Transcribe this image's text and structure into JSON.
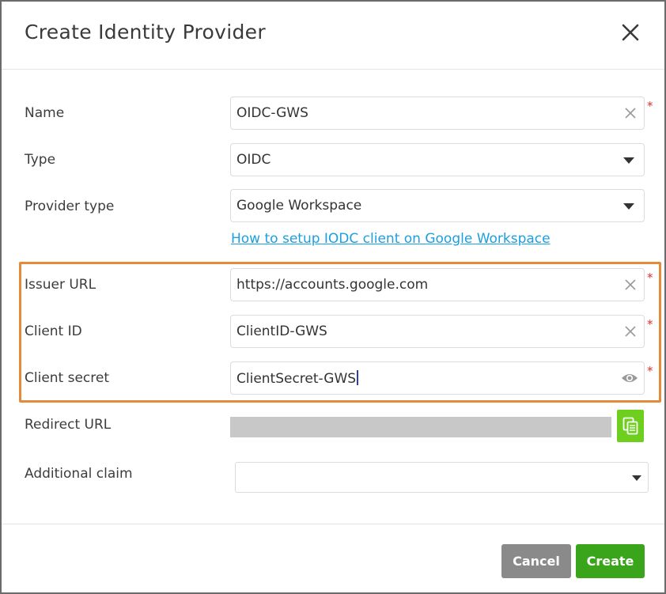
{
  "dialog": {
    "title": "Create Identity Provider",
    "close_icon": "close-icon"
  },
  "form": {
    "name": {
      "label": "Name",
      "value": "OIDC-GWS",
      "required_mark": "*",
      "icon": "clear-icon"
    },
    "type": {
      "label": "Type",
      "value": "OIDC",
      "icon": "caret-down-icon"
    },
    "provider_type": {
      "label": "Provider type",
      "value": "Google Workspace",
      "icon": "caret-down-icon"
    },
    "help_link": "How to setup IODC client on Google Workspace",
    "issuer_url": {
      "label": "Issuer URL",
      "value": "https://accounts.google.com",
      "required_mark": "*",
      "icon": "clear-icon"
    },
    "client_id": {
      "label": "Client ID",
      "value": "ClientID-GWS",
      "required_mark": "*",
      "icon": "clear-icon"
    },
    "client_secret": {
      "label": "Client secret",
      "value": "ClientSecret-GWS",
      "required_mark": "*",
      "icon": "eye-icon"
    },
    "redirect_url": {
      "label": "Redirect URL",
      "icon": "copy-icon"
    },
    "additional_claim": {
      "label": "Additional claim",
      "value": "",
      "icon": "caret-down-icon"
    }
  },
  "footer": {
    "cancel_label": "Cancel",
    "create_label": "Create"
  },
  "colors": {
    "highlight_border": "#e38b3b",
    "link": "#1a9fe0",
    "required": "#e0312b",
    "create_button": "#3aa51a",
    "cancel_button": "#8a8a8a",
    "copy_button": "#6fcf1f"
  }
}
